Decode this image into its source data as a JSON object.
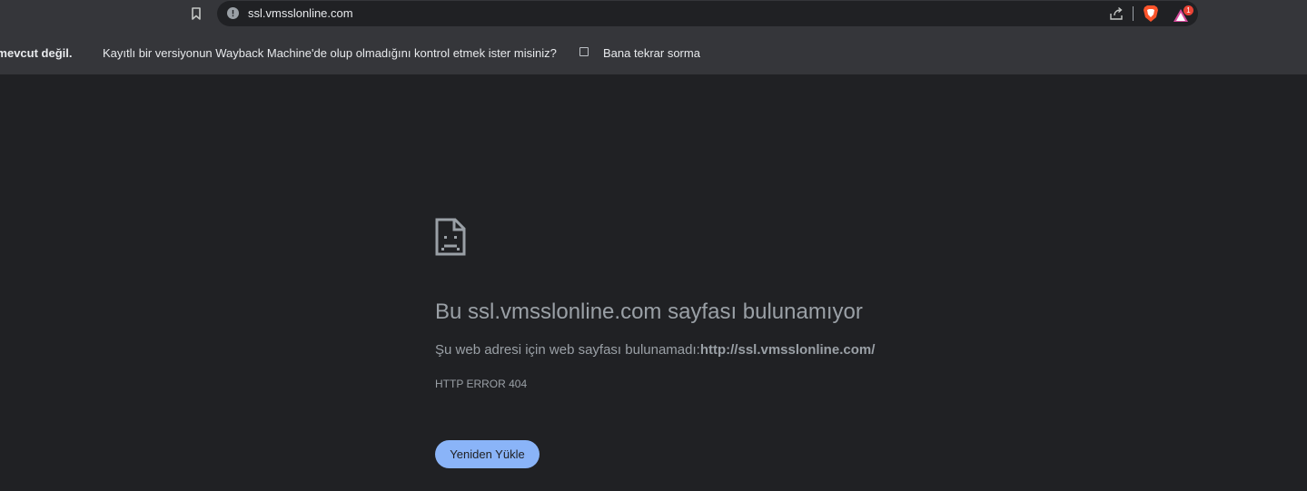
{
  "toolbar": {
    "url": "ssl.vmsslonline.com",
    "rewards_badge_count": "1"
  },
  "infobar": {
    "title": "yfa mevcut değil.",
    "message": "Kayıtlı bir versiyonun Wayback Machine'de olup olmadığını kontrol etmek ister misiniz?",
    "checkbox_label": "Bana tekrar sorma",
    "checkbox_checked": false
  },
  "error": {
    "title": "Bu ssl.vmsslonline.com sayfası bulunamıyor",
    "description_prefix": "Şu web adresi için web sayfası bulunamadı:",
    "description_url": "http://ssl.vmsslonline.com/",
    "code": "HTTP ERROR 404",
    "reload_label": "Yeniden Yükle"
  },
  "colors": {
    "page_background": "#202124",
    "chrome_background": "#35363a",
    "button_blue": "#8ab4f8",
    "text_muted": "#9aa0a6",
    "brave_orange": "#fb542b"
  },
  "icons": [
    "bookmark-icon",
    "info-icon",
    "share-icon",
    "brave-shields-icon",
    "brave-rewards-icon",
    "sad-page-icon"
  ]
}
